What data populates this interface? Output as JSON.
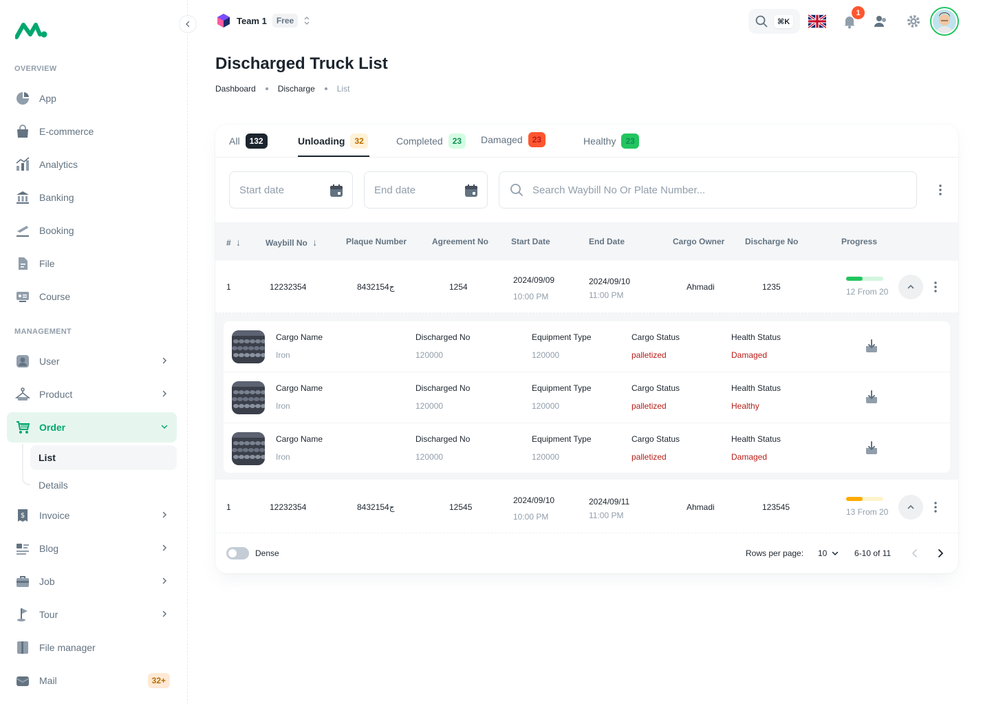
{
  "sidebar": {
    "overview_label": "OVERVIEW",
    "management_label": "MANAGEMENT",
    "overview_items": [
      {
        "label": "App",
        "icon": "app-icon"
      },
      {
        "label": "E-commerce",
        "icon": "shopping-bag-icon"
      },
      {
        "label": "Analytics",
        "icon": "analytics-icon"
      },
      {
        "label": "Banking",
        "icon": "bank-icon"
      },
      {
        "label": "Booking",
        "icon": "booking-icon"
      },
      {
        "label": "File",
        "icon": "file-icon"
      },
      {
        "label": "Course",
        "icon": "course-icon"
      }
    ],
    "management_items": [
      {
        "label": "User",
        "icon": "user-icon"
      },
      {
        "label": "Product",
        "icon": "product-icon"
      },
      {
        "label": "Order",
        "icon": "cart-icon"
      },
      {
        "label": "Invoice",
        "icon": "invoice-icon"
      },
      {
        "label": "Blog",
        "icon": "blog-icon"
      },
      {
        "label": "Job",
        "icon": "job-icon"
      },
      {
        "label": "Tour",
        "icon": "tour-icon"
      },
      {
        "label": "File manager",
        "icon": "folder-icon"
      },
      {
        "label": "Mail",
        "icon": "mail-icon"
      }
    ],
    "order_sub": {
      "list": "List",
      "details": "Details"
    },
    "mail_badge": "32+"
  },
  "header": {
    "team_name": "Team 1",
    "team_plan": "Free",
    "search_shortcut": "⌘K",
    "notification_count": "1"
  },
  "page": {
    "title": "Discharged Truck  List",
    "breadcrumb": [
      "Dashboard",
      "Discharge",
      "List"
    ]
  },
  "tabs": [
    {
      "label": "All",
      "count": "132",
      "bg": "#1c252e",
      "fg": "#ffffff"
    },
    {
      "label": "Unloading",
      "count": "32",
      "bg": "#fff1d6",
      "fg": "#b76e00"
    },
    {
      "label": "Completed",
      "count": "23",
      "bg": "#d3fce2",
      "fg": "#118d57"
    },
    {
      "label": "Damaged",
      "count": "23",
      "bg": "#ff5630",
      "fg": "#b71d18"
    },
    {
      "label": "Healthy",
      "count": "23",
      "bg": "#22c55e",
      "fg": "#118d57"
    }
  ],
  "filters": {
    "start_placeholder": "Start date",
    "end_placeholder": "End date",
    "search_placeholder": "Search Waybill No  Or Plate Number..."
  },
  "columns": [
    "#",
    "Waybill No",
    "Plaque Number",
    "Agreement No",
    "Start Date",
    "End Date",
    "Cargo Owner",
    "Discharge No",
    "Progress"
  ],
  "rows": [
    {
      "index": "1",
      "waybill": "12232354",
      "plaque": "84ج32154",
      "agreement": "1254",
      "start_date": "2024/09/09",
      "start_time": "10:00 PM",
      "end_date": "2024/09/10",
      "end_time": "11:00 PM",
      "owner": "Ahmadi",
      "discharge": "1235",
      "progress_text": "12 From 20",
      "progress": 0.45,
      "progress_color": "#22c55e",
      "progress_track": "#d3f5df"
    },
    {
      "index": "1",
      "waybill": "12232354",
      "plaque": "84ج32154",
      "agreement": "12545",
      "start_date": "2024/09/10",
      "start_time": "10:00 PM",
      "end_date": "2024/09/11",
      "end_time": "11:00 PM",
      "owner": "Ahmadi",
      "discharge": "123545",
      "progress_text": "13 From 20",
      "progress": 0.45,
      "progress_color": "#ffab00",
      "progress_track": "#fff3cc"
    }
  ],
  "cargo_labels": {
    "name": "Cargo Name",
    "discharged": "Discharged No",
    "equipment": "Equipment Type",
    "status": "Cargo Status",
    "health": "Health  Status"
  },
  "cargo_items": [
    {
      "name": "Iron",
      "discharged": "120000",
      "equipment": "120000",
      "status": "palletized",
      "health": "Damaged"
    },
    {
      "name": "Iron",
      "discharged": "120000",
      "equipment": "120000",
      "status": "palletized",
      "health": "Healthy"
    },
    {
      "name": "Iron",
      "discharged": "120000",
      "equipment": "120000",
      "status": "palletized",
      "health": "Damaged"
    }
  ],
  "footer": {
    "dense_label": "Dense",
    "rows_per_page_label": "Rows per page:",
    "rows_per_page": "10",
    "range": "6-10 of 11"
  }
}
